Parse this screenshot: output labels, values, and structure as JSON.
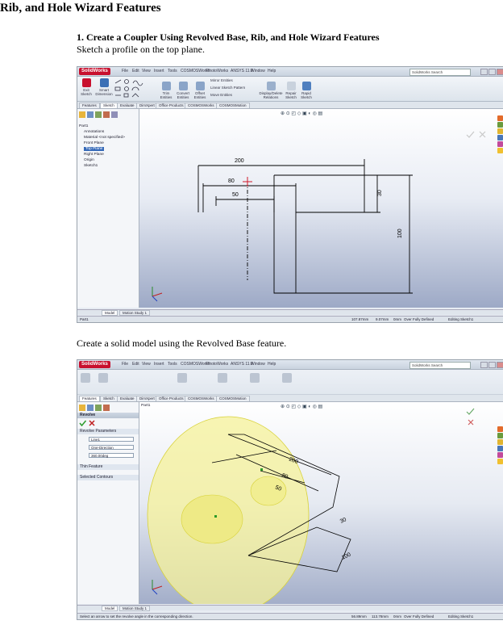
{
  "document": {
    "heading": "Rib, and Hole Wizard Features",
    "section_title": "1. Create a Coupler Using Revolved Base, Rib, and Hole Wizard Features",
    "step1_text": "Sketch a profile on the top plane.",
    "step2_text": "Create a solid model using the Revolved Base feature."
  },
  "app": {
    "logo": "SolidWorks",
    "menus": [
      "File",
      "Edit",
      "View",
      "Insert",
      "Tools",
      "COSMOSWorks",
      "PhotoWorks",
      "ANSYS 11.0",
      "Window",
      "Help"
    ],
    "search_placeholder": "SolidWorks Search",
    "accent_color": "#c8102e"
  },
  "screenshot1": {
    "ribbon_tools": [
      "Exit Sketch",
      "Smart Dimension",
      "Trim Entities",
      "Convert Entities",
      "Offset Entities",
      "Mirror Entities",
      "Linear Sketch Pattern",
      "Move Entities",
      "Display/Delete Relations",
      "Repair Sketch",
      "Rapid Sketch"
    ],
    "tabs": [
      "Features",
      "Sketch",
      "Evaluate",
      "DimXpert",
      "Office Products",
      "COSMOSWorks",
      "COSMOSMotion"
    ],
    "active_tab": "Sketch",
    "tree": [
      "Part1",
      "Annotations",
      "Material <not specified>",
      "Front Plane",
      "Top Plane",
      "Right Plane",
      "Origin",
      "Sketch1"
    ],
    "selected_tree_item": "Top Plane",
    "dimensions": {
      "d200": "200",
      "d80": "80",
      "d50": "50",
      "d30": "30",
      "d100": "100"
    },
    "bottom_tabs": [
      "Model",
      "Motion Study 1"
    ],
    "status": {
      "left": "Part1",
      "x": "107.87mm",
      "y": "9.07mm",
      "z": "0mm",
      "defined": "Over Fully Defined",
      "mode": "Editing Sketch1"
    }
  },
  "screenshot2": {
    "tabs": [
      "Features",
      "Sketch",
      "Evaluate",
      "DimXpert",
      "Office Products",
      "COSMOSWorks",
      "COSMOSMotion"
    ],
    "active_tab": "Features",
    "tree_root": "Part1",
    "property_manager": {
      "title": "Revolve",
      "section_params": "Revolve Parameters",
      "axis_value": "Line1",
      "direction_value": "One-Direction",
      "angle_value": "360.00deg",
      "thin_feature": "Thin Feature",
      "selected_contours": "Selected Contours"
    },
    "dimensions": {
      "d200": "200",
      "d80": "80",
      "d50": "50",
      "d30": "30",
      "d100": "100"
    },
    "bottom_tabs": [
      "Model",
      "Motion Study 1"
    ],
    "status": {
      "left": "Select an arrow to set the revolve angle in the corresponding direction.",
      "x": "56.89mm",
      "y": "113.78mm",
      "z": "0mm",
      "defined": "Over Fully Defined",
      "mode": "Editing Sketch1"
    }
  }
}
